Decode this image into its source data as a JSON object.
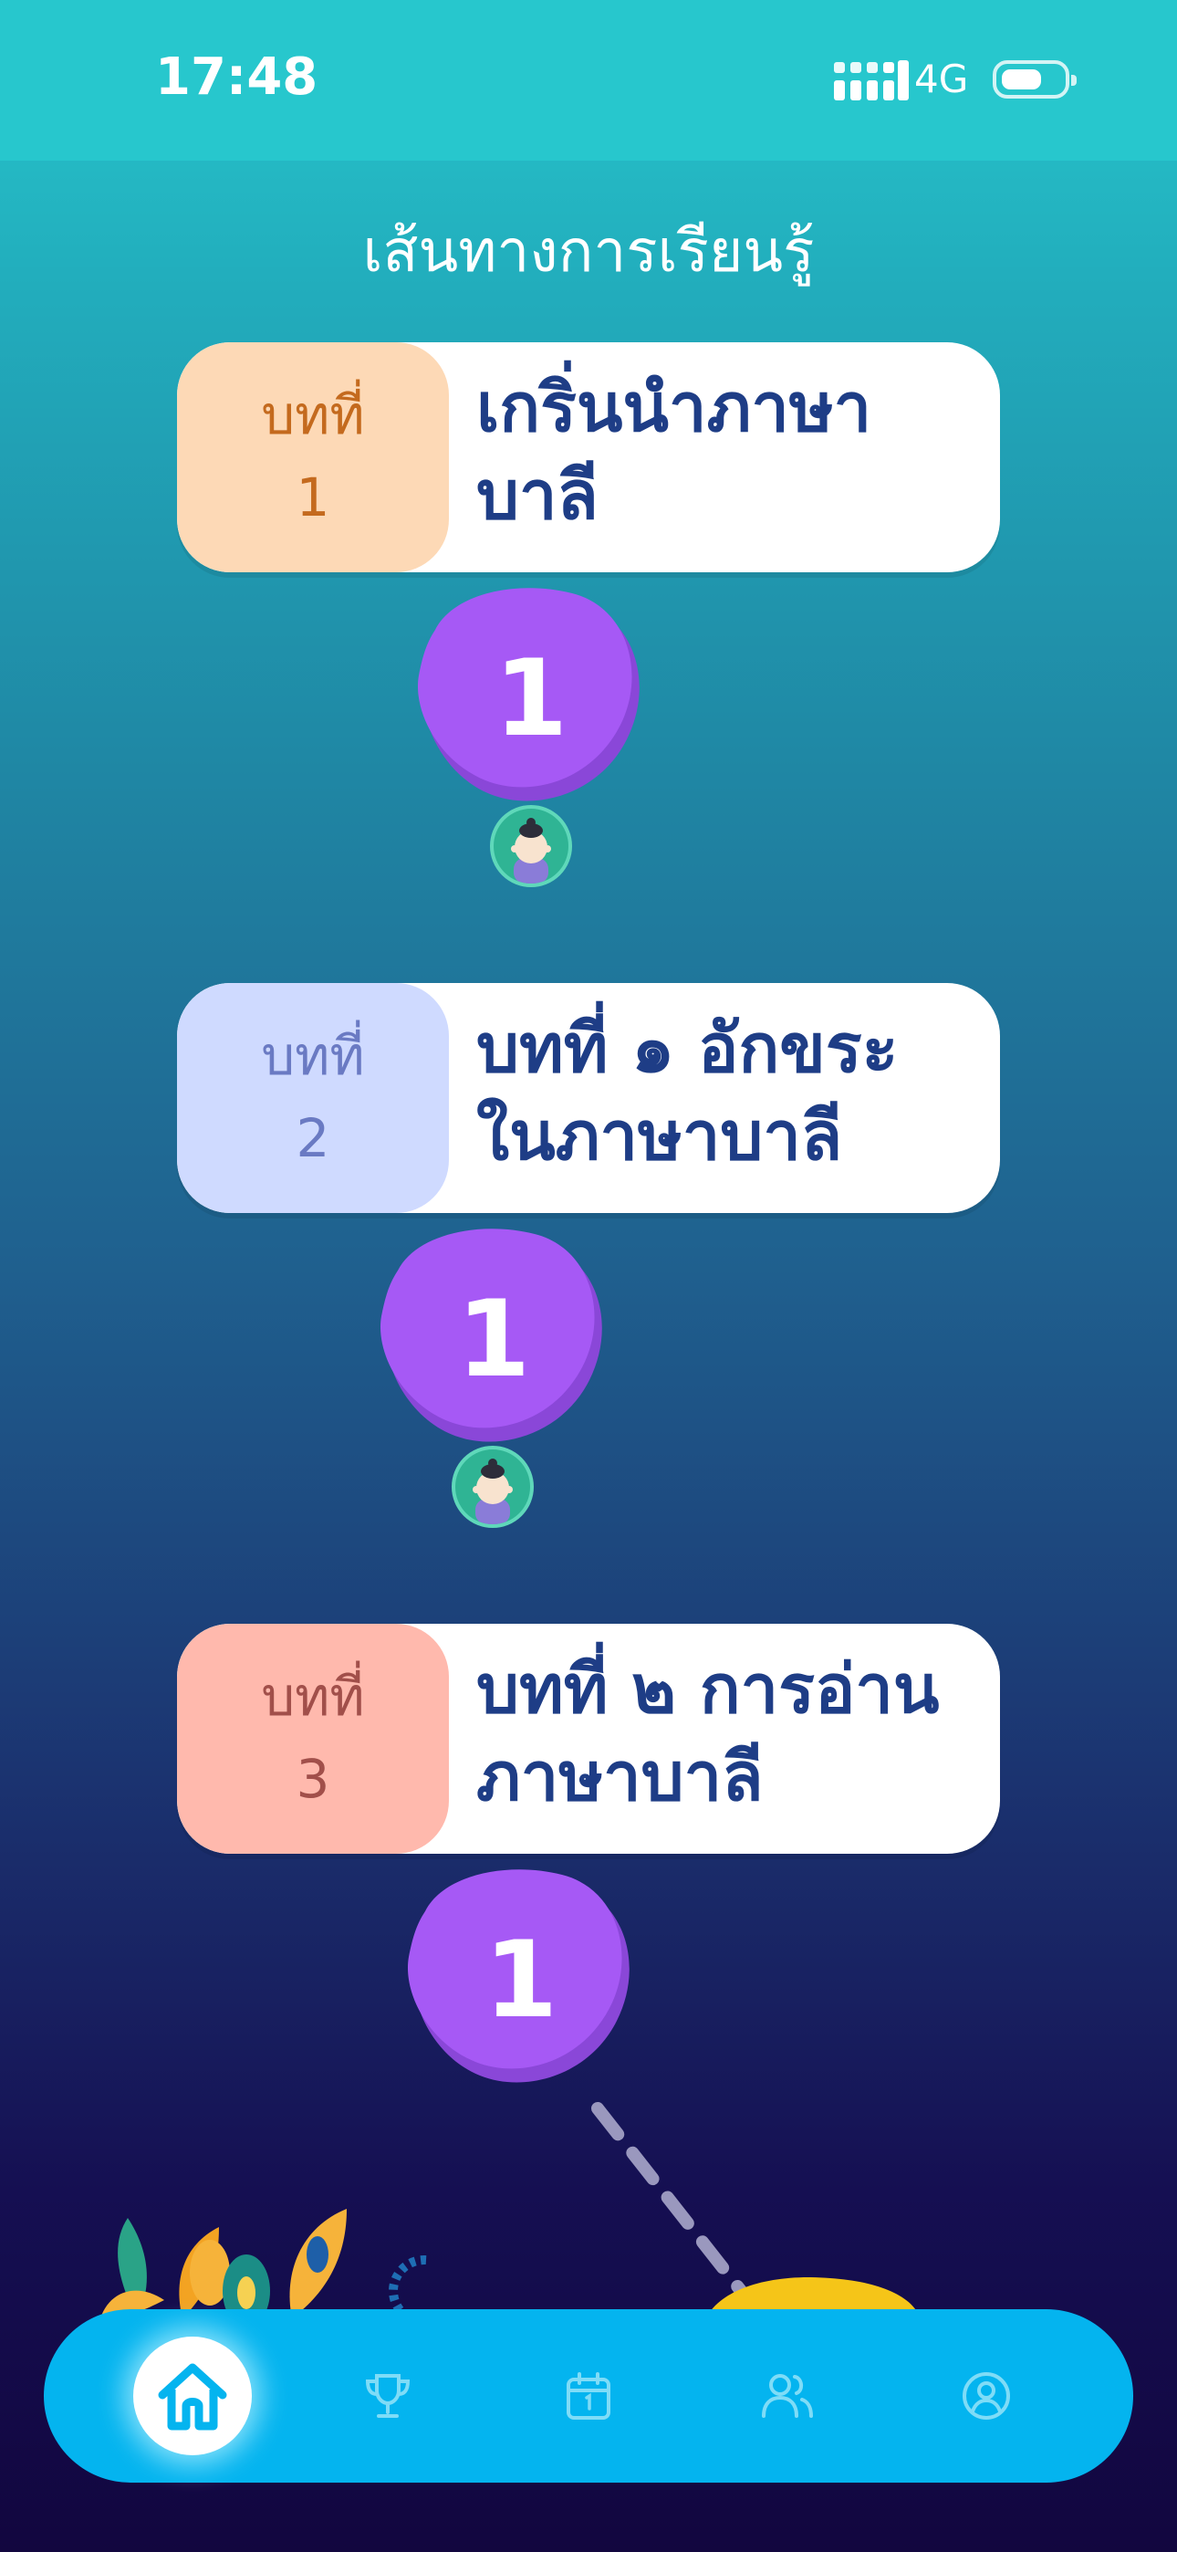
{
  "status_bar": {
    "time": "17:48",
    "network": "4G",
    "battery_level": 0.7
  },
  "header": {
    "title": "เส้นทางการเรียนรู้"
  },
  "lessons": [
    {
      "badge_label": "บทที่",
      "badge_number": "1",
      "title_line1": "เกริ่นนำภาษา",
      "title_line2": "บาลี",
      "badge_bg": "#fdd9b6",
      "badge_color": "#c46a1e",
      "level": "1"
    },
    {
      "badge_label": "บทที่",
      "badge_number": "2",
      "title_line1": "บทที่ ๑ อักขระ",
      "title_line2": "ในภาษาบาลี",
      "badge_bg": "#cfdaff",
      "badge_color": "#6a7ac3",
      "level": "1"
    },
    {
      "badge_label": "บทที่",
      "badge_number": "3",
      "title_line1": "บทที่ ๒ การอ่าน",
      "title_line2": "ภาษาบาลี",
      "badge_bg": "#ffb9ad",
      "badge_color": "#a14f4a",
      "level": "1"
    }
  ],
  "colors": {
    "node_purple": "#a659f5",
    "node_shadow": "#8a47d8",
    "nav_bg": "#04b4ef",
    "card_title": "#1e3d86"
  },
  "nav": {
    "items": [
      "home-icon",
      "trophy-icon",
      "calendar-icon",
      "friends-icon",
      "profile-icon"
    ],
    "active": "home-icon"
  }
}
